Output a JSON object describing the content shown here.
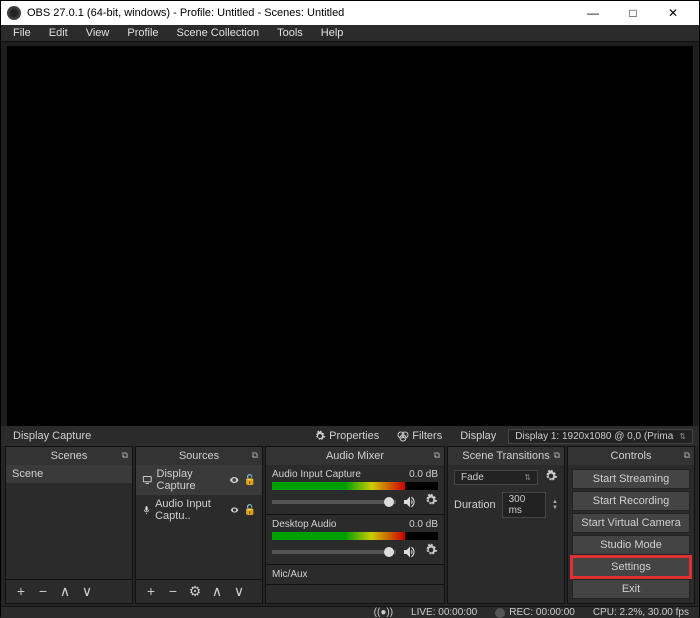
{
  "titlebar": {
    "title": "OBS 27.0.1 (64-bit, windows) - Profile: Untitled - Scenes: Untitled"
  },
  "menubar": [
    "File",
    "Edit",
    "View",
    "Profile",
    "Scene Collection",
    "Tools",
    "Help"
  ],
  "scene_label": "Display Capture",
  "toolbar": {
    "properties": "Properties",
    "filters": "Filters",
    "display_btn": "Display",
    "display_combo": "Display 1: 1920x1080 @ 0,0 (Prima"
  },
  "panels": {
    "scenes": {
      "title": "Scenes",
      "items": [
        "Scene"
      ]
    },
    "sources": {
      "title": "Sources",
      "items": [
        {
          "label": "Display Capture",
          "icon": "display"
        },
        {
          "label": "Audio Input Captu..",
          "icon": "mic"
        }
      ]
    },
    "mixer": {
      "title": "Audio Mixer",
      "channels": [
        {
          "name": "Audio Input Capture",
          "db": "0.0 dB"
        },
        {
          "name": "Desktop Audio",
          "db": "0.0 dB"
        },
        {
          "name": "Mic/Aux",
          "db": ""
        }
      ]
    },
    "transitions": {
      "title": "Scene Transitions",
      "fade": "Fade",
      "duration_label": "Duration",
      "duration_value": "300 ms"
    },
    "controls": {
      "title": "Controls",
      "buttons": [
        "Start Streaming",
        "Start Recording",
        "Start Virtual Camera",
        "Studio Mode",
        "Settings",
        "Exit"
      ],
      "highlight_index": 4
    }
  },
  "statusbar": {
    "live": "LIVE: 00:00:00",
    "rec": "REC: 00:00:00",
    "cpu": "CPU: 2.2%, 30.00 fps"
  }
}
